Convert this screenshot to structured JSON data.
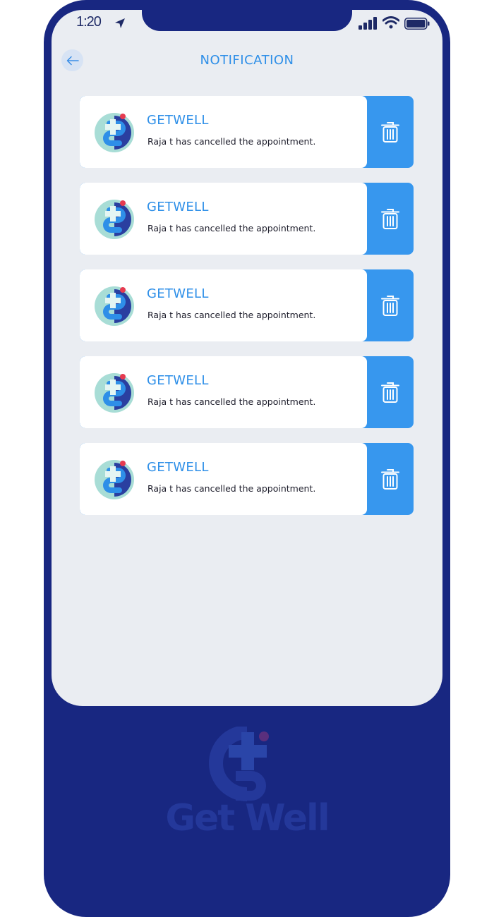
{
  "status_bar": {
    "time": "1:20"
  },
  "header": {
    "title": "NOTIFICATION"
  },
  "notifications": [
    {
      "title": "GETWELL",
      "message": "Raja t has cancelled the appointment."
    },
    {
      "title": "GETWELL",
      "message": "Raja t has cancelled the appointment."
    },
    {
      "title": "GETWELL",
      "message": "Raja t has cancelled the appointment."
    },
    {
      "title": "GETWELL",
      "message": "Raja t has cancelled the appointment."
    },
    {
      "title": "GETWELL",
      "message": "Raja t has cancelled the appointment."
    }
  ],
  "brand": {
    "name": "Get Well"
  },
  "colors": {
    "frame": "#182781",
    "accent": "#2e8fe8",
    "delete": "#3797ee",
    "screen_bg": "#eaedf2"
  },
  "icons": {
    "back": "arrow-left-icon",
    "delete": "trash-icon",
    "location": "location-arrow-icon",
    "signal": "signal-icon",
    "wifi": "wifi-icon",
    "battery": "battery-icon"
  }
}
